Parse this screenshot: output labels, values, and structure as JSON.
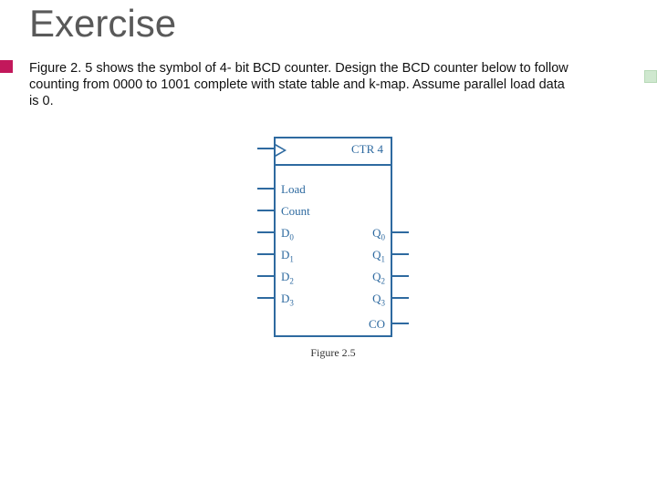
{
  "title": "Exercise",
  "body": "Figure 2. 5 shows the symbol of 4- bit BCD counter. Design the BCD counter below to follow counting from 0000 to 1001 complete with state table and k-map. Assume parallel load data is 0.",
  "figure": {
    "ctr_label": "CTR 4",
    "left_signals": [
      "Load",
      "Count",
      "D0",
      "D1",
      "D2",
      "D3"
    ],
    "right_signals": [
      "Q0",
      "Q1",
      "Q2",
      "Q3",
      "CO"
    ],
    "caption": "Figure 2.5"
  }
}
